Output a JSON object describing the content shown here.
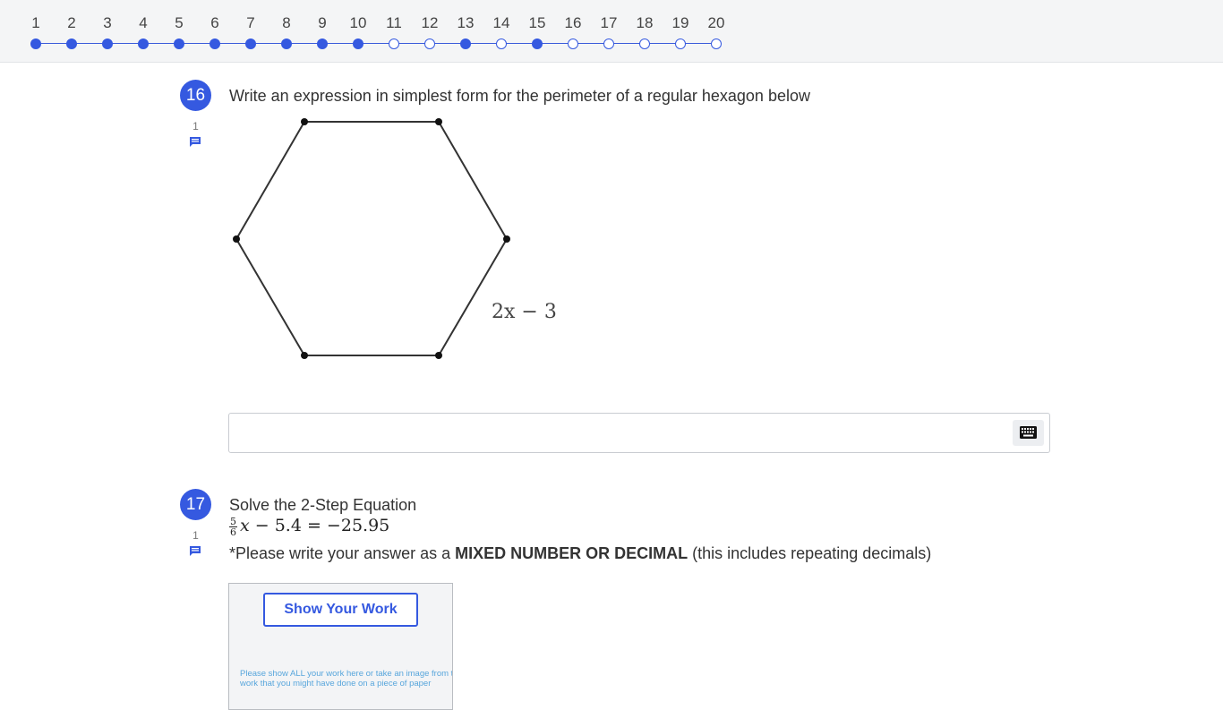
{
  "progress": {
    "questions": [
      {
        "label": "1",
        "answered": true
      },
      {
        "label": "2",
        "answered": true
      },
      {
        "label": "3",
        "answered": true
      },
      {
        "label": "4",
        "answered": true
      },
      {
        "label": "5",
        "answered": true
      },
      {
        "label": "6",
        "answered": true
      },
      {
        "label": "7",
        "answered": true
      },
      {
        "label": "8",
        "answered": true
      },
      {
        "label": "9",
        "answered": true
      },
      {
        "label": "10",
        "answered": true
      },
      {
        "label": "11",
        "answered": false
      },
      {
        "label": "12",
        "answered": false
      },
      {
        "label": "13",
        "answered": true
      },
      {
        "label": "14",
        "answered": false
      },
      {
        "label": "15",
        "answered": true
      },
      {
        "label": "16",
        "answered": false
      },
      {
        "label": "17",
        "answered": false
      },
      {
        "label": "18",
        "answered": false
      },
      {
        "label": "19",
        "answered": false
      },
      {
        "label": "20",
        "answered": false
      }
    ]
  },
  "q16": {
    "number": "16",
    "count": "1",
    "prompt": "Write an expression in simplest form for the perimeter of a regular hexagon below",
    "figure_label": "2x − 3",
    "answer_value": "",
    "keyboard_icon": "keyboard-icon",
    "comment_icon": "comment-icon"
  },
  "q17": {
    "number": "17",
    "count": "1",
    "title": "Solve the 2-Step Equation",
    "equation": {
      "frac_num": "5",
      "frac_den": "6",
      "variable": "x",
      "rest": " − 5.4 = −25.95"
    },
    "instruction_pre": "*Please write your answer as a ",
    "instruction_bold": "MIXED NUMBER OR DECIMAL",
    "instruction_post": " (this includes repeating decimals)",
    "work_button": "Show Your Work",
    "work_hint": "Please show ALL your work here or take an image from the work that you might have done on a piece of paper"
  },
  "colors": {
    "accent": "#3559e0",
    "topbar_bg": "#f4f5f6",
    "hint_text": "#58a6dc"
  }
}
